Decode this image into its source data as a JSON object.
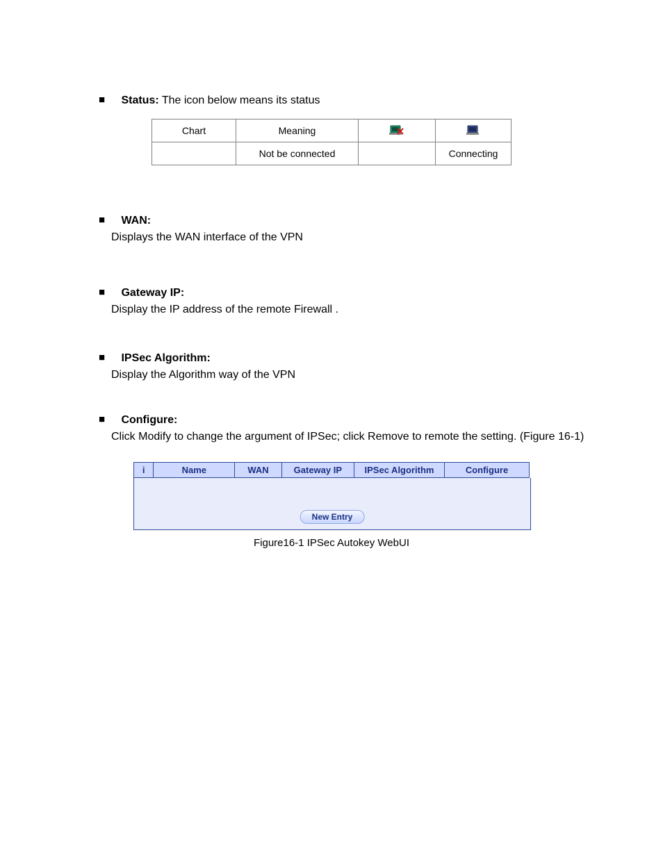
{
  "bullets": {
    "status": {
      "heading": "Status:",
      "body": "The icon below means its status"
    },
    "wan": {
      "heading": "WAN:",
      "body": "Displays the WAN interface of the VPN"
    },
    "gateway": {
      "heading": "Gateway IP:",
      "body": "Display the IP address of the remote Firewall ."
    },
    "algorithm": {
      "heading": "IPSec Algorithm:",
      "body": "Display the Algorithm way of the VPN"
    },
    "configure": {
      "heading": "Configure:",
      "body": "Click Modify to change the argument of IPSec; click Remove to remote the setting. (Figure 16-1)"
    }
  },
  "status_table": {
    "row1": {
      "c1": "Chart",
      "c2": "Meaning",
      "c3_icon": "disconnect-icon",
      "c4_icon": "connect-icon"
    },
    "row2": {
      "c1": "",
      "c2": "Not be connected",
      "c3": "",
      "c4": "Connecting"
    }
  },
  "ipsec_table": {
    "headers": {
      "i": "i",
      "name": "Name",
      "wan": "WAN",
      "gw": "Gateway IP",
      "alg": "IPSec Algorithm",
      "conf": "Configure"
    },
    "new_entry": "New Entry"
  },
  "caption": "Figure16-1 IPSec Autokey WebUI"
}
